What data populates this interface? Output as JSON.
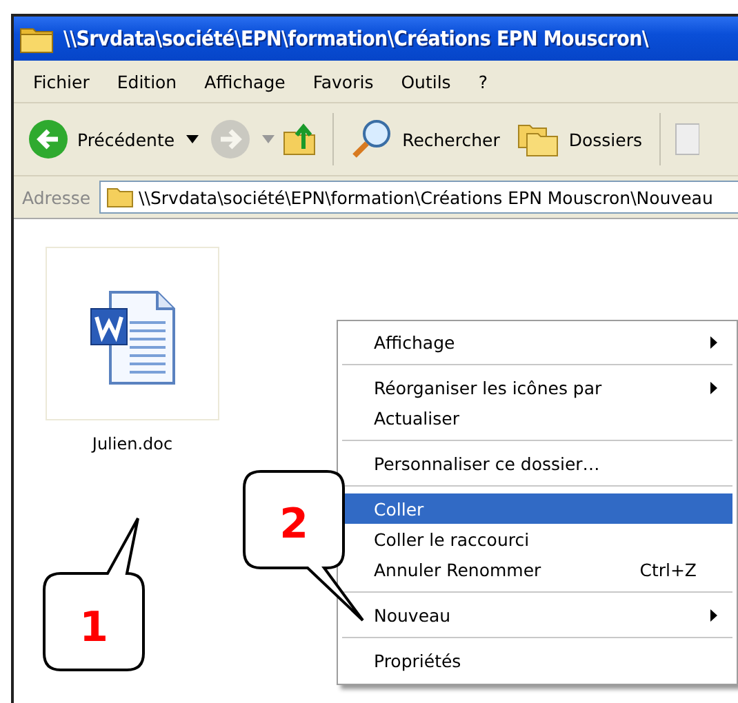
{
  "window": {
    "title": "\\\\Srvdata\\société\\EPN\\formation\\Créations EPN Mouscron\\"
  },
  "menu_bar": [
    "Fichier",
    "Edition",
    "Affichage",
    "Favoris",
    "Outils",
    "?"
  ],
  "toolbar": {
    "back": {
      "label": "Précédente",
      "disabled": false
    },
    "forward": {
      "disabled": true
    },
    "search": {
      "label": "Rechercher"
    },
    "folders": {
      "label": "Dossiers"
    }
  },
  "address_bar": {
    "label": "Adresse",
    "value": "\\\\Srvdata\\société\\EPN\\formation\\Créations EPN Mouscron\\Nouveau"
  },
  "files": [
    {
      "name": "Julien.doc",
      "kind": "word"
    }
  ],
  "context_menu": [
    [
      {
        "label": "Affichage",
        "submenu": true,
        "selected": false
      }
    ],
    [
      {
        "label": "Réorganiser les icônes par",
        "submenu": true,
        "selected": false
      },
      {
        "label": "Actualiser",
        "submenu": false,
        "selected": false
      }
    ],
    [
      {
        "label": "Personnaliser ce dossier…",
        "submenu": false,
        "selected": false
      }
    ],
    [
      {
        "label": "Coller",
        "submenu": false,
        "selected": true
      },
      {
        "label": "Coller le raccourci",
        "submenu": false,
        "selected": false
      },
      {
        "label": "Annuler Renommer",
        "shortcut": "Ctrl+Z",
        "submenu": false,
        "selected": false
      }
    ],
    [
      {
        "label": "Nouveau",
        "submenu": true,
        "selected": false
      }
    ],
    [
      {
        "label": "Propriétés",
        "submenu": false,
        "selected": false
      }
    ]
  ],
  "callouts": [
    {
      "label": "1"
    },
    {
      "label": "2"
    }
  ]
}
